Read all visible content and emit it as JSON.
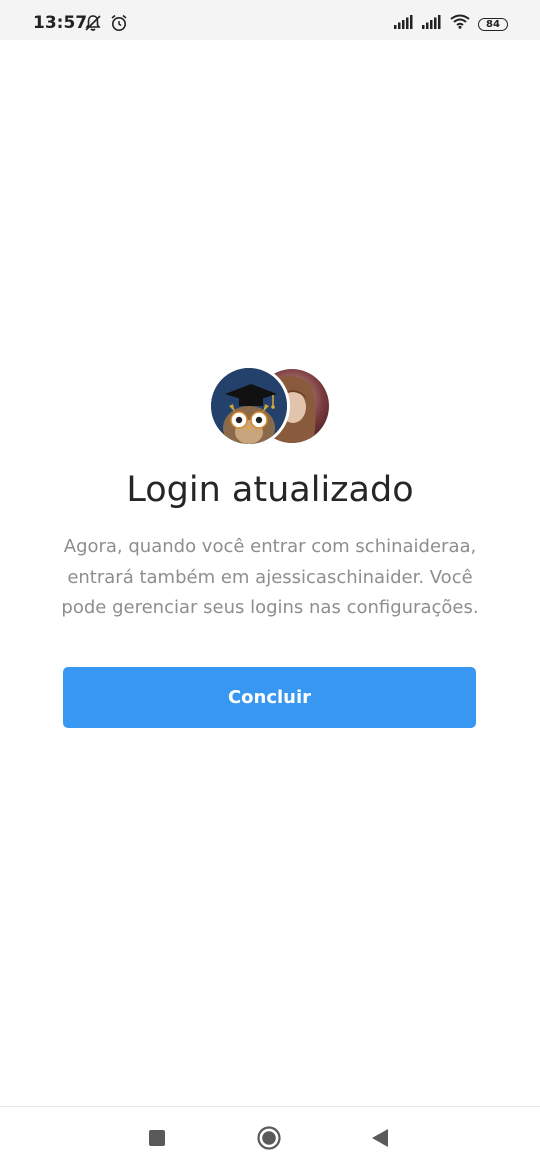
{
  "status_bar": {
    "time": "13:57",
    "battery": "84",
    "icons": [
      "notifications-off-icon",
      "alarm-icon",
      "signal-icon",
      "signal-icon",
      "wifi-icon",
      "battery-icon"
    ]
  },
  "dialog": {
    "title": "Login atualizado",
    "description": "Agora, quando você entrar com schinaideraa, entrará também em ajessicaschinaider. Você pode gerenciar seus logins nas configurações.",
    "done_label": "Concluir",
    "accent_color": "#3897f0"
  },
  "nav_bar": {
    "icons": [
      "recents-icon",
      "home-icon",
      "back-icon"
    ]
  }
}
